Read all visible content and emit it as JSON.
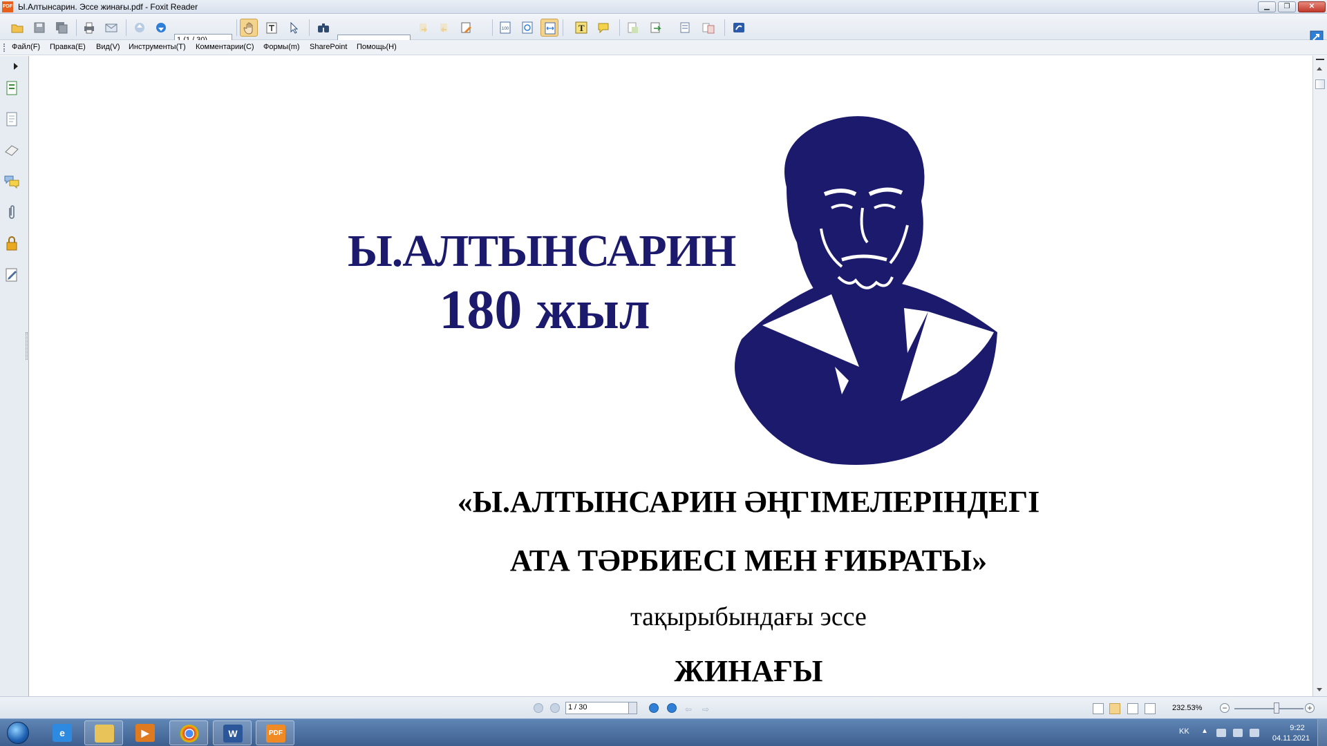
{
  "window": {
    "title": "Ы.Алтынсарин. Эссе жинағы.pdf - Foxit Reader",
    "app_icon_label": "PDF"
  },
  "toolbar": {
    "page_field_value": "1 (1 / 30)",
    "find_field_value": "",
    "icons": [
      "open-icon",
      "save-icon",
      "save-all-icon",
      "print-icon",
      "email-icon",
      "prev-page-icon",
      "next-page-icon",
      "hand-tool-icon",
      "select-text-icon",
      "select-icon",
      "find-icon",
      "find-prev-icon",
      "find-next-icon",
      "highlight-icon",
      "zoom-actual-icon",
      "fit-page-icon",
      "fit-width-icon",
      "typewriter-icon",
      "note-icon",
      "create-pdf-icon",
      "export-icon",
      "pdf-to-word-icon",
      "convert-icon",
      "sharepoint-icon"
    ]
  },
  "menu": {
    "items": [
      "Файл(F)",
      "Правка(E)",
      "Вид(V)",
      "Инструменты(T)",
      "Комментарии(C)",
      "Формы(m)",
      "SharePoint",
      "Помощь(H)"
    ]
  },
  "sidebar": {
    "icons": [
      "pages-icon",
      "bookmarks-icon",
      "layers-icon",
      "comments-icon",
      "attachments-icon",
      "security-icon",
      "signatures-icon"
    ]
  },
  "document": {
    "logo_name": "Ы.АЛТЫНСАРИН",
    "logo_years": "180 жыл",
    "title_line1": "«Ы.АЛТЫНСАРИН ӘҢГІМЕЛЕРІНДЕГІ",
    "title_line2": "АТА ТӘРБИЕСІ МЕН ҒИБРАТЫ»",
    "subtitle": "тақырыбындағы эссе",
    "title_line3": "ЖИНАҒЫ",
    "logo_color": "#1c1a6d"
  },
  "statusbar": {
    "page_value": "1 / 30",
    "zoom": "232.53%"
  },
  "taskbar": {
    "apps": [
      "internet-explorer-icon",
      "file-explorer-icon",
      "media-player-icon",
      "chrome-icon",
      "word-icon",
      "foxit-reader-icon"
    ],
    "tray_language": "KK",
    "time": "9:22",
    "date": "04.11.2021"
  }
}
